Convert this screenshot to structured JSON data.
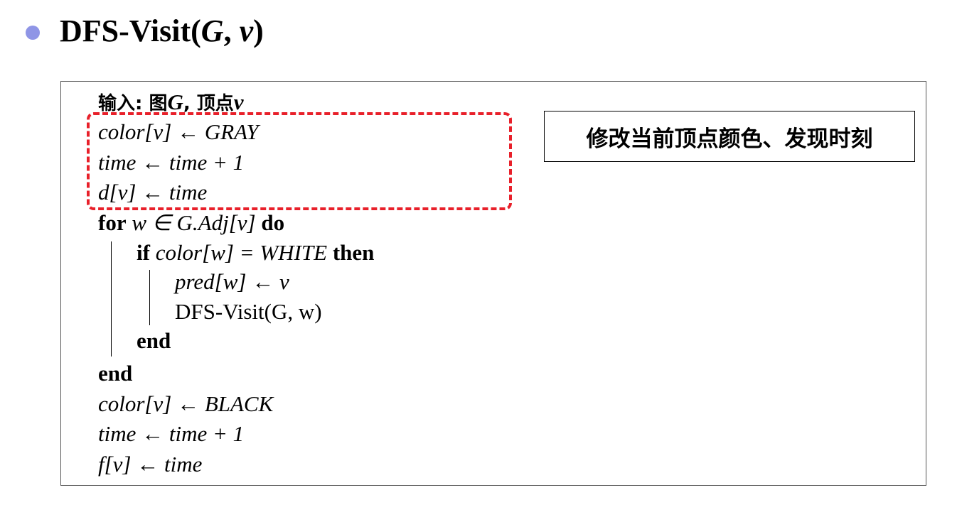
{
  "header": {
    "title_prefix": "DFS-Visit(",
    "title_arg1": "G",
    "title_sep": ", ",
    "title_arg2": "v",
    "title_suffix": ")"
  },
  "algorithm": {
    "input_label": "输入: 图",
    "input_graph": "G",
    "input_sep": ", 顶点",
    "input_vertex": "v",
    "line_color_gray": "color[v] ← GRAY",
    "line_time_inc_1": "time ← time + 1",
    "line_d_time": "d[v] ← time",
    "for_keyword": "for",
    "for_condition": "w ∈ G.Adj[v]",
    "do_keyword": "do",
    "if_keyword": "if",
    "if_condition": "color[w] = WHITE",
    "then_keyword": "then",
    "line_pred": "pred[w] ← v",
    "line_recursive_call": "DFS-Visit(G, w)",
    "end_if": "end",
    "end_for": "end",
    "line_color_black": "color[v] ← BLACK",
    "line_time_inc_2": "time ← time + 1",
    "line_f_time": "f[v] ← time"
  },
  "annotation": {
    "text": "修改当前顶点颜色、发现时刻"
  },
  "colors": {
    "bullet": "#8f95e6",
    "highlight": "#e8202a"
  }
}
